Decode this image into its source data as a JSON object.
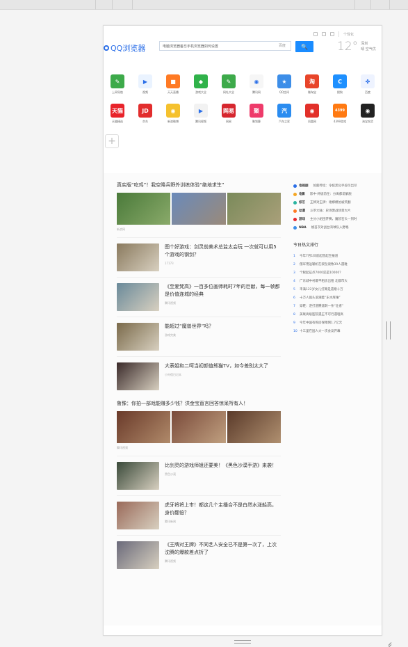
{
  "browser": {
    "logo_text": "QQ浏览器",
    "search_placeholder": "电脑浏览器备忘手机浏览器如何设置",
    "search_engine": "百度",
    "search_button": "🔍",
    "weather": {
      "temp": "12°",
      "city": "深圳",
      "desc": "晴 空气优"
    },
    "toolbar_label": "个性化"
  },
  "apps_row1": [
    {
      "name": "上网导航",
      "icon": "edit-icon",
      "color": "#3daa4a",
      "glyph": "✎"
    },
    {
      "name": "视频",
      "icon": "play-icon",
      "color": "#eaf3ff",
      "glyph": "▶"
    },
    {
      "name": "天天直播",
      "icon": "camera-icon",
      "color": "#ff7a24",
      "glyph": "■"
    },
    {
      "name": "游戏大全",
      "icon": "gamepad-icon",
      "color": "#30b24a",
      "glyph": "◆"
    },
    {
      "name": "网址大全",
      "icon": "edit-icon",
      "color": "#3daa4a",
      "glyph": "✎"
    },
    {
      "name": "腾讯网",
      "icon": "qq-news-icon",
      "color": "#f6f6f6",
      "glyph": "◉"
    },
    {
      "name": "QQ空间",
      "icon": "star-icon",
      "color": "#3d8ee8",
      "glyph": "★"
    },
    {
      "name": "微淘宝",
      "icon": "taobao-icon",
      "color": "#e8452a",
      "glyph": "淘"
    },
    {
      "name": "搜狗",
      "icon": "refresh-icon",
      "color": "#1e90ff",
      "glyph": "C"
    },
    {
      "name": "百度",
      "icon": "paw-icon",
      "color": "#eef3ff",
      "glyph": "✤"
    }
  ],
  "apps_row2": [
    {
      "name": "天猫精选",
      "icon": "tmall-icon",
      "color": "#e8232a",
      "glyph": "天猫"
    },
    {
      "name": "京东",
      "icon": "jd-icon",
      "color": "#e22d2d",
      "glyph": "JD"
    },
    {
      "name": "新浪微博",
      "icon": "weibo-icon",
      "color": "#f5c12e",
      "glyph": "◉"
    },
    {
      "name": "腾讯视频",
      "icon": "tencent-video-icon",
      "color": "#f2f2f2",
      "glyph": "▶"
    },
    {
      "name": "网易",
      "icon": "netease-icon",
      "color": "#d6262e",
      "glyph": "网易"
    },
    {
      "name": "聚划算",
      "icon": "juhuasuan-icon",
      "color": "#ee3b6a",
      "glyph": "聚"
    },
    {
      "name": "汽车之家",
      "icon": "car-icon",
      "color": "#2a8cf0",
      "glyph": "汽"
    },
    {
      "name": "凤凰网",
      "icon": "phoenix-icon",
      "color": "#e2302a",
      "glyph": "◉"
    },
    {
      "name": "4399游戏",
      "icon": "4399-icon",
      "color": "#ff7a12",
      "glyph": "4399"
    },
    {
      "name": "淘宝吃货",
      "icon": "food-icon",
      "color": "#222222",
      "glyph": "◉"
    }
  ],
  "feed": {
    "headline": "真实版“吃鸡”！我空降兵野外训练体验“绝地求生”",
    "headline_source": "新浪网",
    "items1": [
      {
        "title": "图个好游戏：剑灵前美术总监太会玩 一次就可以用5个游戏的钢剑？",
        "source": "17173",
        "color": "#8a7a5e"
      },
      {
        "title": "《至爱梵高》一百多位画师耗时7年的巨献，每一帧都是价值连城的经典",
        "source": "腾讯视频",
        "color": "#6a8a9a"
      },
      {
        "title": "能超过“魔兽世界”吗？",
        "source": "游戏完美",
        "color": "#7a6a4a"
      },
      {
        "title": "大表姐和二呵当初颜值熊猫TV，如今差别太大了",
        "source": "小外宿日记本",
        "color": "#3a2a2a"
      }
    ],
    "headline2": "鲁豫：你拍一部戏能赚多少钱？洪金宝直言回答惊呆所有人！",
    "headline2_source": "腾讯视频",
    "items2": [
      {
        "title": "比剑灵的游戏师姐还要美！《黑色沙漠手游》来袭！",
        "source": "黑色沙漠",
        "color": "#3a4a3a"
      },
      {
        "title": "虎牙将将上市！都这几个主播合不是白然水涨船高，身价翻倍？",
        "source": "腾讯新闻",
        "color": "#9a6a5a"
      },
      {
        "title": "《王牌对王牌》不同艺人安全已不是第一次了，上次沈腾的爆款差点折了",
        "source": "腾讯视频",
        "color": "#6a6a7a"
      }
    ]
  },
  "sidebar": {
    "categories": [
      {
        "cat": "电视剧",
        "text": "如懿传续：令嫔黑化手段尽出尽",
        "color": "#2a6ee8"
      },
      {
        "cat": "电影",
        "text": "影中·终极前任：分离都说解脱",
        "color": "#f5a623"
      },
      {
        "cat": "综艺",
        "text": "王牌对王牌：谢娜模仿被笑翻",
        "color": "#2ab4a0"
      },
      {
        "cat": "动漫",
        "text": "斗罗大陆：史诗萧战场景大片",
        "color": "#ff7a24"
      },
      {
        "cat": "游戏",
        "text": "主分小组团开赛，魔装石头—到时",
        "color": "#e8232a"
      },
      {
        "cat": "NBA",
        "text": "姚首次对战台湾球队入野格",
        "color": "#3d8ee8"
      }
    ],
    "hot_title": "今日热文排行",
    "hot": [
      "今年7月1日前起售起至报道",
      "俄军用运输机在叙坠毁致39人遇难",
      "个税起征点7000还是10000？",
      "广东城中村最平租房出租 北都市大",
      "丰满122岁女儿打算是遗赠十万",
      "十万人囤头浪潮着“东水库难”",
      "穿鞋：逆打道腾遥刺一条“壮者”",
      "美联高级医院遇正不可行遇理高",
      "今年中国有购房保障网1.7亿元",
      "十三里在国人大一次会议开幕"
    ]
  }
}
